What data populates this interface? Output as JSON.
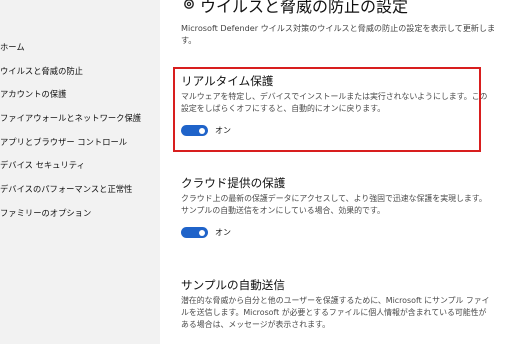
{
  "sidebar": {
    "items": [
      {
        "label": "ホーム"
      },
      {
        "label": "ウイルスと脅威の防止"
      },
      {
        "label": "アカウントの保護"
      },
      {
        "label": "ファイアウォールとネットワーク保護"
      },
      {
        "label": "アプリとブラウザー コントロール"
      },
      {
        "label": "デバイス セキュリティ"
      },
      {
        "label": "デバイスのパフォーマンスと正常性"
      },
      {
        "label": "ファミリーのオプション"
      }
    ]
  },
  "header": {
    "title": "ウイルスと脅威の防止の設定",
    "description": "Microsoft Defender ウイルス対策のウイルスと脅威の防止の設定を表示して更新します。"
  },
  "sections": {
    "realtime": {
      "title": "リアルタイム保護",
      "description": "マルウェアを特定し、デバイスでインストールまたは実行されないようにします。この設定をしばらくオフにすると、自動的にオンに戻ります。",
      "toggle_label": "オン"
    },
    "cloud": {
      "title": "クラウド提供の保護",
      "description": "クラウド上の最新の保護データにアクセスして、より強固で迅速な保護を実現します。サンプルの自動送信をオンにしている場合、効果的です。",
      "toggle_label": "オン"
    },
    "sample": {
      "title": "サンプルの自動送信",
      "description": "潜在的な脅威から自分と他のユーザーを保護するために、Microsoft にサンプル ファイルを送信します。Microsoft が必要とするファイルに個人情報が含まれている可能性がある場合は、メッセージが表示されます。"
    }
  },
  "colors": {
    "accent": "#1f63c9",
    "highlight": "#d81e1e"
  }
}
